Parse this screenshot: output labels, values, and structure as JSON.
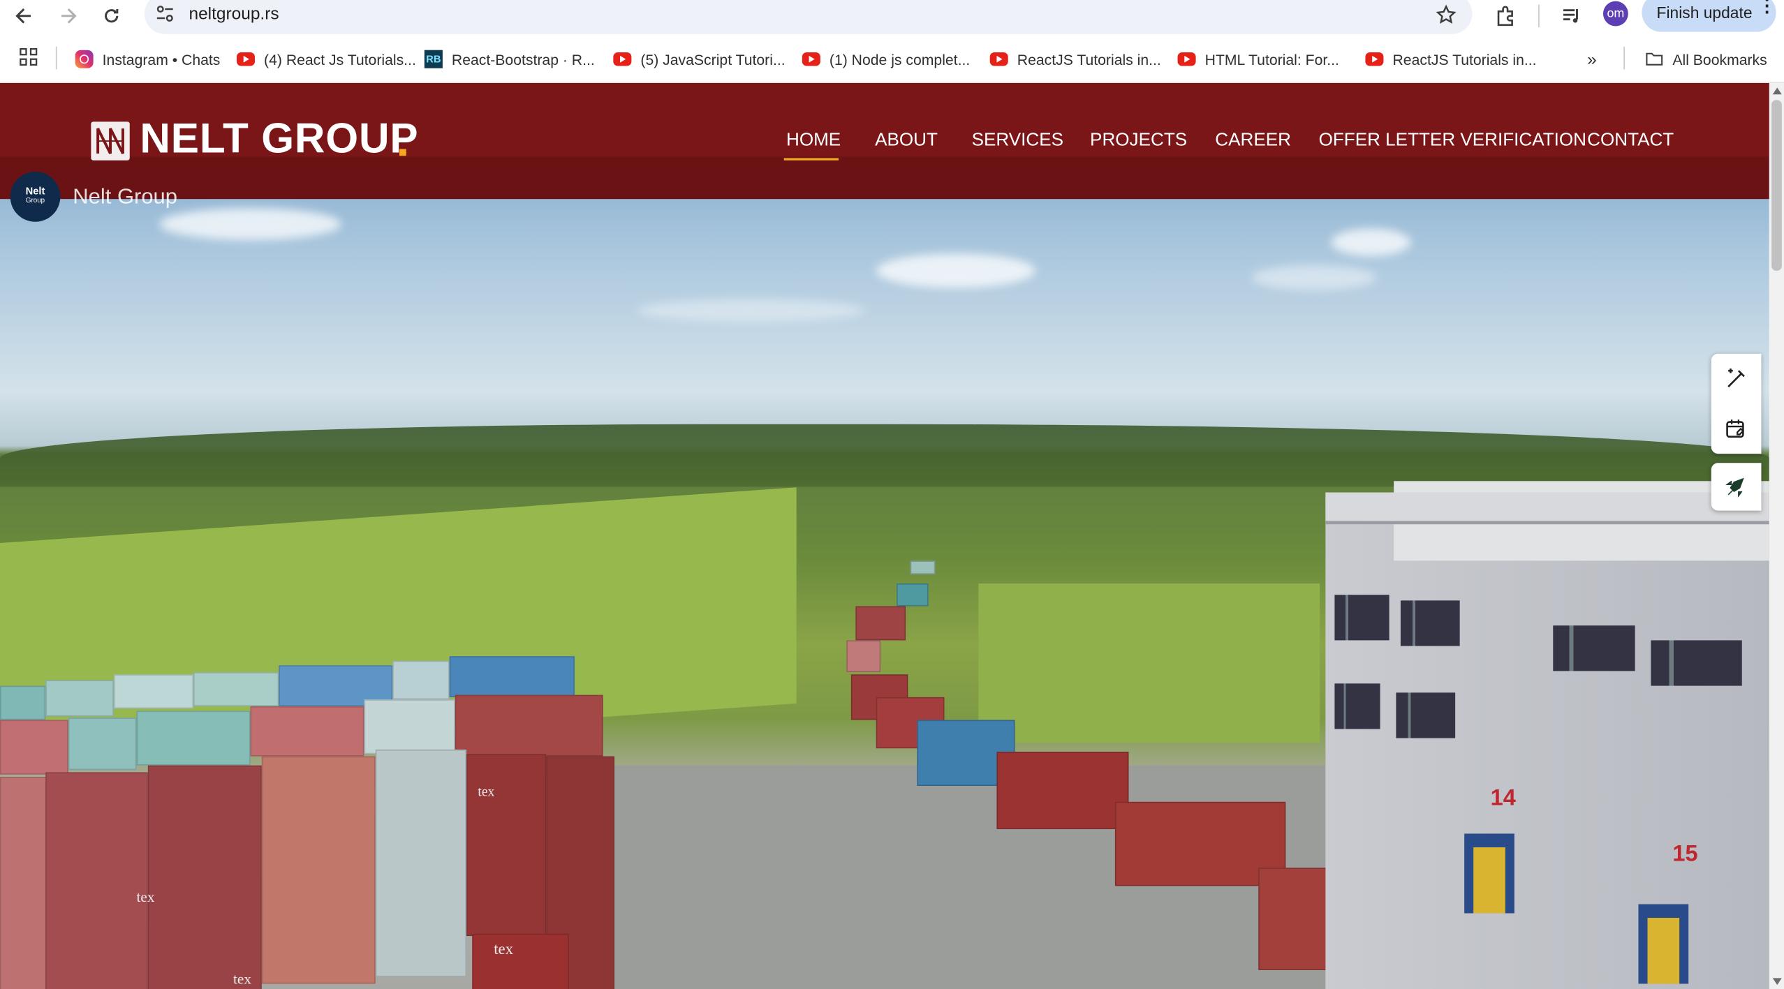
{
  "browser": {
    "url": "neltgroup.rs",
    "profile_initials": "om",
    "finish_update_label": "Finish update",
    "bookmarks": [
      {
        "label": "Instagram • Chats",
        "icon": "instagram-icon"
      },
      {
        "label": "(4) React Js Tutorials...",
        "icon": "youtube-icon"
      },
      {
        "label": "React-Bootstrap · R...",
        "icon": "react-bootstrap-icon"
      },
      {
        "label": "(5) JavaScript Tutori...",
        "icon": "youtube-icon"
      },
      {
        "label": "(1) Node js complet...",
        "icon": "youtube-icon"
      },
      {
        "label": "ReactJS Tutorials in...",
        "icon": "youtube-icon"
      },
      {
        "label": "HTML Tutorial: For...",
        "icon": "youtube-icon"
      },
      {
        "label": "ReactJS Tutorials in...",
        "icon": "youtube-icon"
      }
    ],
    "all_bookmarks_label": "All Bookmarks"
  },
  "site": {
    "logo_text": "NELT GROUP",
    "nav": [
      {
        "label": "HOME",
        "active": true
      },
      {
        "label": "ABOUT",
        "active": false
      },
      {
        "label": "SERVICES",
        "active": false
      },
      {
        "label": "PROJECTS",
        "active": false
      },
      {
        "label": "CAREER",
        "active": false
      },
      {
        "label": "OFFER LETTER VERIFICATION",
        "active": false
      },
      {
        "label": "CONTACT",
        "active": false
      }
    ],
    "video": {
      "channel_logo_line1": "Nelt",
      "channel_logo_line2": "Group",
      "title": "Nelt Group",
      "dock_numbers": [
        "14",
        "15"
      ],
      "container_label": "tex"
    }
  },
  "colors": {
    "nav_bg": "#7a1518",
    "accent": "#f5a623",
    "chrome_update": "#c9dcf7"
  }
}
